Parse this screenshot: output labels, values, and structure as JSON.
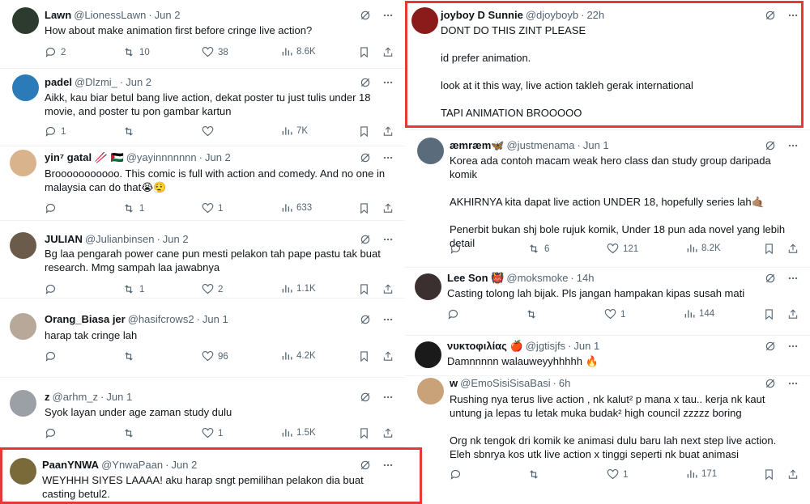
{
  "tweets": [
    {
      "id": "lawn",
      "name": "Lawn",
      "handle": "@LionessLawn",
      "date": "Jun 2",
      "text": [
        "How about make animation first before cringe live action?"
      ],
      "reply": "2",
      "retweet": "10",
      "like": "38",
      "views": "8.6K",
      "avatar": "#2d3a2e"
    },
    {
      "id": "padel",
      "name": "padel",
      "handle": "@Dlzmi_",
      "date": "Jun 2",
      "text": [
        "Aikk, kau biar betul bang live action, dekat poster tu just tulis under 18 movie, and poster tu pon gambar kartun"
      ],
      "reply": "1",
      "retweet": "",
      "like": "",
      "views": "7K",
      "avatar": "#2b7bb9"
    },
    {
      "id": "yin",
      "name": "yin⁷ gatal 🥢 🇵🇸",
      "handle": "@yayinnnnnnn",
      "date": "Jun 2",
      "text": [
        "Brooooooooooo. This comic is full with action and comedy. And no one in malaysia can do that😭😮‍💨"
      ],
      "reply": "",
      "retweet": "1",
      "like": "1",
      "views": "633",
      "avatar": "#d9b38c"
    },
    {
      "id": "julian",
      "name": "JULIAN",
      "handle": "@Julianbinsen",
      "date": "Jun 2",
      "text": [
        "Bg laa pengarah power cane pun mesti pelakon tah pape pastu tak buat research. Mmg sampah laa jawabnya"
      ],
      "reply": "",
      "retweet": "1",
      "like": "2",
      "views": "1.1K",
      "avatar": "#6b5b4a"
    },
    {
      "id": "orang",
      "name": "Orang_Biasa jer",
      "handle": "@hasifcrows2",
      "date": "Jun 1",
      "text": [
        "harap tak cringe lah"
      ],
      "reply": "",
      "retweet": "",
      "like": "96",
      "views": "4.2K",
      "avatar": "#b8a89a"
    },
    {
      "id": "z",
      "name": "z",
      "handle": "@arhm_z",
      "date": "Jun 1",
      "text": [
        "Syok layan under age zaman study dulu"
      ],
      "reply": "",
      "retweet": "",
      "like": "1",
      "views": "1.5K",
      "avatar": "#9aa0a6"
    },
    {
      "id": "paan",
      "name": "PaanYNWA",
      "handle": "@YnwaPaan",
      "date": "Jun 2",
      "text": [
        "WEYHHH SIYES LAAAA! aku harap sngt pemilihan pelakon dia buat casting betul2."
      ],
      "reply": "",
      "retweet": "",
      "like": "",
      "views": "",
      "avatar": "#7a6a3a"
    },
    {
      "id": "joyboy",
      "name": "joyboy D Sunnie",
      "handle": "@djoyboyb",
      "date": "22h",
      "text": [
        "DONT DO THIS ZINT PLEASE",
        "id prefer animation.",
        "look at it this way, live action takleh gerak international",
        "TAPI ANIMATION BROOOOO"
      ],
      "reply": "",
      "retweet": "",
      "like": "",
      "views": "",
      "avatar": "#8b1a1a"
    },
    {
      "id": "aemraem",
      "name": "æmræm🦋",
      "handle": "@justmenama",
      "date": "Jun 1",
      "text": [
        "Korea ada contoh macam weak hero class dan study group daripada komik",
        "AKHIRNYA kita dapat live action UNDER 18, hopefully series lah🤙🏽",
        "Penerbit bukan shj bole rujuk komik, Under 18 pun ada novel yang lebih detail"
      ],
      "reply": "",
      "retweet": "6",
      "like": "121",
      "views": "8.2K",
      "avatar": "#5a6b7c"
    },
    {
      "id": "leeson",
      "name": "Lee Son 👹",
      "handle": "@moksmoke",
      "date": "14h",
      "text": [
        "Casting tolong lah bijak. Pls jangan hampakan kipas susah mati"
      ],
      "reply": "",
      "retweet": "",
      "like": "1",
      "views": "144",
      "avatar": "#3b2f2f"
    },
    {
      "id": "nykto",
      "name": "νυκτοφιλίας 🍎",
      "handle": "@jgtisjfs",
      "date": "Jun 1",
      "text": [
        "Damnnnnn walauweyyhhhhh 🔥"
      ],
      "reply": "",
      "retweet": "",
      "like": "",
      "views": "",
      "avatar": "#1a1a1a"
    },
    {
      "id": "w",
      "name": "w",
      "handle": "@EmoSisiSisaBasi",
      "date": "6h",
      "text": [
        "Rushing nya terus live action , nk kalut² p mana x tau.. kerja nk kaut untung ja lepas tu letak muka budak² high council zzzzz boring",
        "Org nk tengok dri komik ke animasi dulu baru lah next step live action. Eleh sbnrya kos utk live action x tinggi seperti nk buat animasi"
      ],
      "reply": "",
      "retweet": "",
      "like": "1",
      "views": "171",
      "avatar": "#c9a27a"
    }
  ],
  "icons": {
    "grok": "grok-icon",
    "more": "more-icon",
    "reply": "reply-icon",
    "retweet": "retweet-icon",
    "like": "like-icon",
    "views": "views-icon",
    "bookmark": "bookmark-icon",
    "share": "share-icon"
  },
  "colors": {
    "highlight": "#e53935",
    "muted": "#536471",
    "text": "#0f1419",
    "divider": "#eff3f4"
  }
}
